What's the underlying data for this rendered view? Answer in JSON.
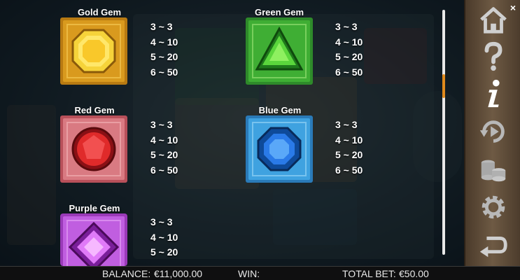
{
  "paytable": {
    "gems": [
      {
        "name": "Gold Gem",
        "pays": [
          "3 ~ 3",
          "4 ~ 10",
          "5 ~ 20",
          "6 ~ 50"
        ],
        "color": "#f2b21a"
      },
      {
        "name": "Green Gem",
        "pays": [
          "3 ~ 3",
          "4 ~ 10",
          "5 ~ 20",
          "6 ~ 50"
        ],
        "color": "#3fbf3a"
      },
      {
        "name": "Red Gem",
        "pays": [
          "3 ~ 3",
          "4 ~ 10",
          "5 ~ 20",
          "6 ~ 50"
        ],
        "color": "#e0474a"
      },
      {
        "name": "Blue Gem",
        "pays": [
          "3 ~ 3",
          "4 ~ 10",
          "5 ~ 20",
          "6 ~ 50"
        ],
        "color": "#2f9fe0"
      },
      {
        "name": "Purple Gem",
        "pays": [
          "3 ~ 3",
          "4 ~ 10",
          "5 ~ 20"
        ],
        "color": "#c25ee0"
      }
    ]
  },
  "menu": {
    "icons": [
      "home-icon",
      "help-icon",
      "info-icon",
      "autoplay-icon",
      "coins-icon",
      "settings-icon",
      "back-icon"
    ],
    "close_label": "×"
  },
  "bottom_bar": {
    "balance_label": "BALANCE:",
    "balance_value": "€11,000.00",
    "win_label": "WIN:",
    "win_value": "",
    "total_bet_label": "TOTAL BET:",
    "total_bet_value": "€50.00"
  },
  "colors": {
    "accent": "#e08a1c",
    "menu_bg": "#5e4c38",
    "bar_bg": "#0f0f10"
  }
}
